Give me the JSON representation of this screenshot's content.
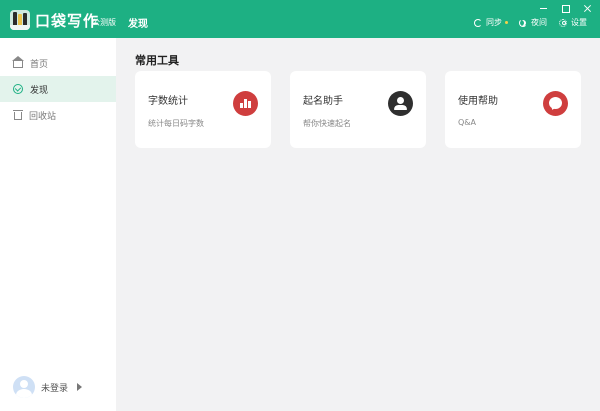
{
  "app": {
    "name": "口袋写作",
    "edition": "公测版",
    "current_page": "发现",
    "accent_color": "#1db083"
  },
  "titlebar": {
    "sync_label": "同步",
    "night_label": "夜间",
    "settings_label": "设置",
    "icons": [
      "sync-icon",
      "moon-icon",
      "gear-icon",
      "minimize-icon",
      "maximize-icon",
      "close-icon"
    ]
  },
  "sidebar": {
    "items": [
      {
        "label": "首页",
        "icon": "home-icon",
        "active": false
      },
      {
        "label": "发现",
        "icon": "discover-icon",
        "active": true
      },
      {
        "label": "回收站",
        "icon": "trash-icon",
        "active": false
      }
    ],
    "user": {
      "label": "未登录",
      "icon": "avatar"
    }
  },
  "main": {
    "section_title": "常用工具",
    "cards": [
      {
        "title": "字数统计",
        "subtitle": "统计每日码字数",
        "icon": "bar-chart-icon",
        "icon_color": "#cf3e3e"
      },
      {
        "title": "起名助手",
        "subtitle": "帮你快速起名",
        "icon": "user-icon",
        "icon_color": "#2f2f2f"
      },
      {
        "title": "使用帮助",
        "subtitle": "Q&A",
        "icon": "chat-bubble-icon",
        "icon_color": "#cf3e3e"
      }
    ]
  }
}
